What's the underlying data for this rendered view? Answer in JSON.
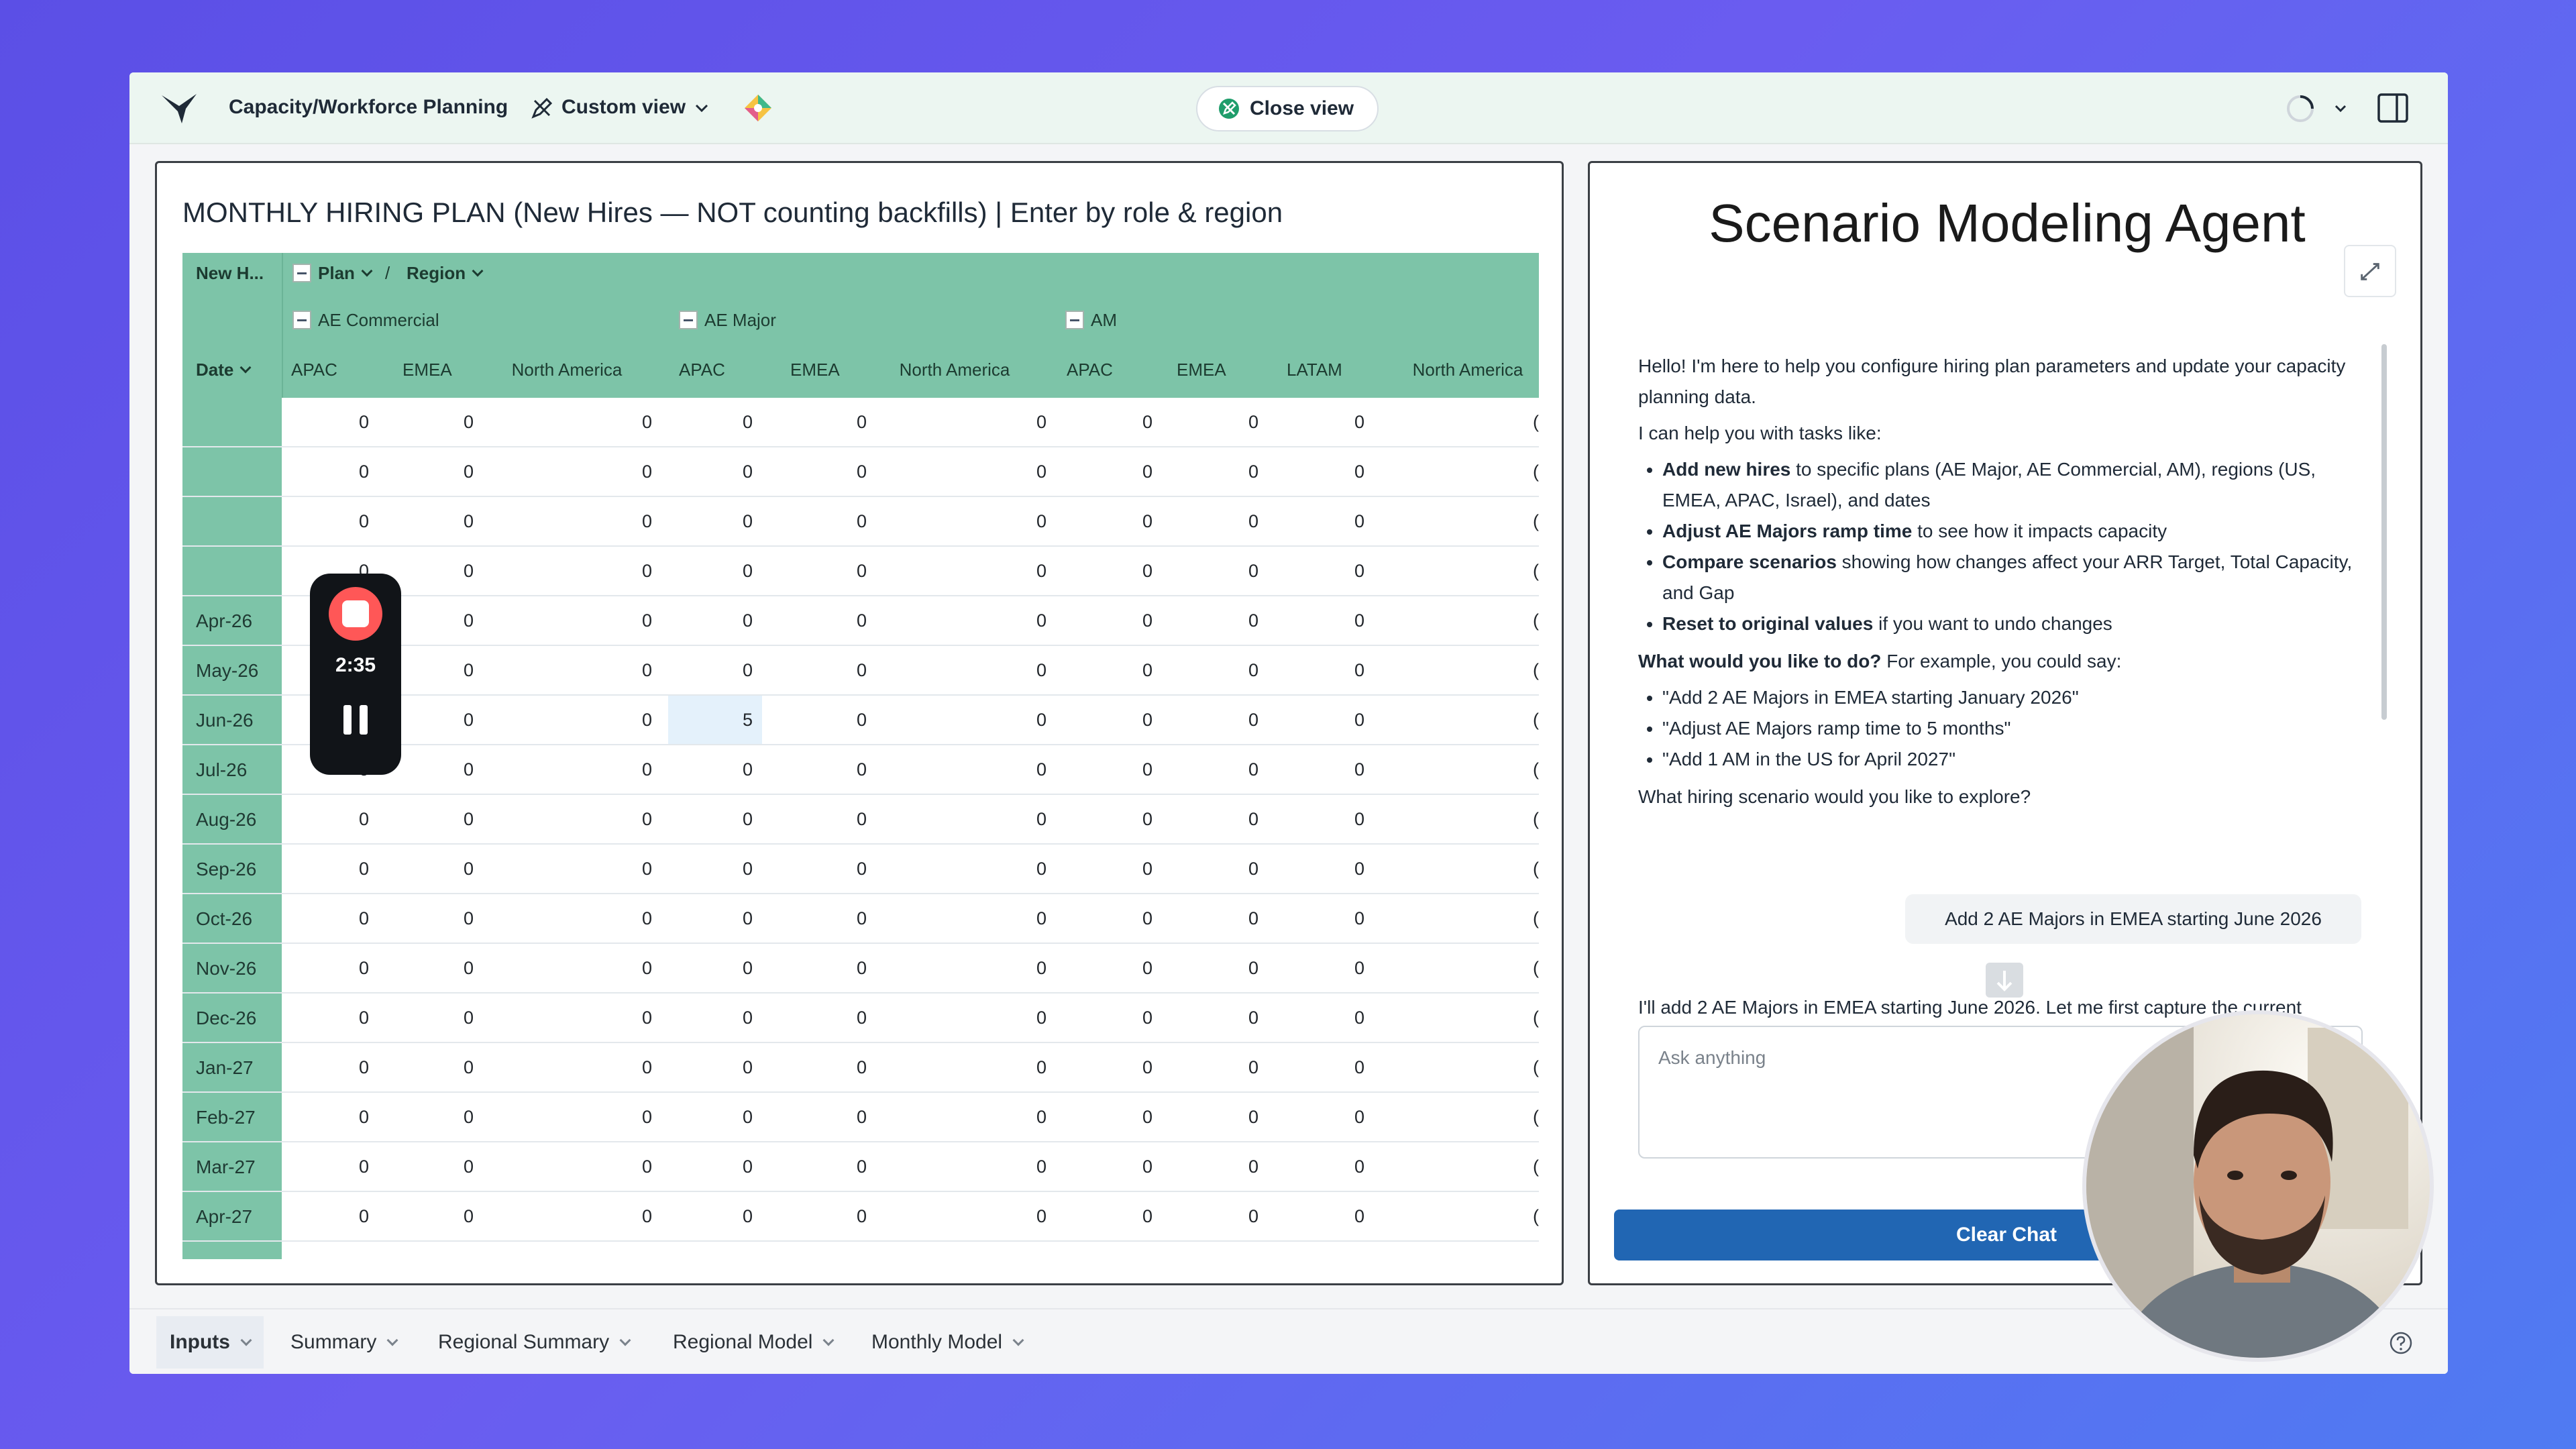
{
  "topbar": {
    "title": "Capacity/Workforce Planning",
    "view_label": "Custom view",
    "close_view_label": "Close view"
  },
  "left_panel": {
    "title": "MONTHLY HIRING PLAN (New Hires — NOT counting backfills) | Enter by role & region",
    "corner_label": "New H...",
    "plan_label": "Plan",
    "slash": "/",
    "region_label": "Region",
    "date_label": "Date",
    "groups": [
      "AE Commercial",
      "AE Major",
      "AM"
    ],
    "columns": [
      "APAC",
      "EMEA",
      "North America",
      "APAC",
      "EMEA",
      "North America",
      "APAC",
      "EMEA",
      "LATAM",
      "North America"
    ],
    "rows": [
      {
        "date": "",
        "values": [
          0,
          0,
          0,
          0,
          0,
          0,
          0,
          0,
          0
        ]
      },
      {
        "date": "",
        "values": [
          0,
          0,
          0,
          0,
          0,
          0,
          0,
          0,
          0
        ]
      },
      {
        "date": "",
        "values": [
          0,
          0,
          0,
          0,
          0,
          0,
          0,
          0,
          0
        ]
      },
      {
        "date": "",
        "values": [
          0,
          0,
          0,
          0,
          0,
          0,
          0,
          0,
          0
        ]
      },
      {
        "date": "Apr-26",
        "values": [
          0,
          0,
          0,
          0,
          0,
          0,
          0,
          0,
          0
        ]
      },
      {
        "date": "May-26",
        "values": [
          0,
          0,
          0,
          0,
          0,
          0,
          0,
          0,
          0
        ]
      },
      {
        "date": "Jun-26",
        "values": [
          0,
          0,
          0,
          5,
          0,
          0,
          0,
          0,
          0
        ]
      },
      {
        "date": "Jul-26",
        "values": [
          0,
          0,
          0,
          0,
          0,
          0,
          0,
          0,
          0
        ]
      },
      {
        "date": "Aug-26",
        "values": [
          0,
          0,
          0,
          0,
          0,
          0,
          0,
          0,
          0
        ]
      },
      {
        "date": "Sep-26",
        "values": [
          0,
          0,
          0,
          0,
          0,
          0,
          0,
          0,
          0
        ]
      },
      {
        "date": "Oct-26",
        "values": [
          0,
          0,
          0,
          0,
          0,
          0,
          0,
          0,
          0
        ]
      },
      {
        "date": "Nov-26",
        "values": [
          0,
          0,
          0,
          0,
          0,
          0,
          0,
          0,
          0
        ]
      },
      {
        "date": "Dec-26",
        "values": [
          0,
          0,
          0,
          0,
          0,
          0,
          0,
          0,
          0
        ]
      },
      {
        "date": "Jan-27",
        "values": [
          0,
          0,
          0,
          0,
          0,
          0,
          0,
          0,
          0
        ]
      },
      {
        "date": "Feb-27",
        "values": [
          0,
          0,
          0,
          0,
          0,
          0,
          0,
          0,
          0
        ]
      },
      {
        "date": "Mar-27",
        "values": [
          0,
          0,
          0,
          0,
          0,
          0,
          0,
          0,
          0
        ]
      },
      {
        "date": "Apr-27",
        "values": [
          0,
          0,
          0,
          0,
          0,
          0,
          0,
          0,
          0
        ]
      }
    ],
    "trailing_glyph": "(",
    "highlighted_cell": {
      "row": 6,
      "col": 3
    }
  },
  "recorder": {
    "time": "2:35"
  },
  "right_panel": {
    "title": "Scenario Modeling Agent",
    "intro": "Hello! I'm here to help you configure hiring plan parameters and update your capacity planning data.",
    "tasks_intro": "I can help you with tasks like:",
    "tasks": [
      {
        "bold": "Add new hires",
        "rest": " to specific plans (AE Major, AE Commercial, AM), regions (US, EMEA, APAC, Israel), and dates"
      },
      {
        "bold": "Adjust AE Majors ramp time",
        "rest": " to see how it impacts capacity"
      },
      {
        "bold": "Compare scenarios",
        "rest": " showing how changes affect your ARR Target, Total Capacity, and Gap"
      },
      {
        "bold": "Reset to original values",
        "rest": " if you want to undo changes"
      }
    ],
    "question_bold": "What would you like to do?",
    "question_rest": " For example, you could say:",
    "examples": [
      "\"Add 2 AE Majors in EMEA starting January 2026\"",
      "\"Adjust AE Majors ramp time to 5 months\"",
      "\"Add 1 AM in the US for April 2027\""
    ],
    "closing": "What hiring scenario would you like to explore?",
    "user_message": "Add 2 AE Majors in EMEA starting June 2026",
    "assistant_partial": "I'll add 2 AE Majors in EMEA starting June 2026. Let me first capture the current",
    "input_placeholder": "Ask anything",
    "clear_label": "Clear Chat"
  },
  "tabs": [
    {
      "label": "Inputs",
      "active": true
    },
    {
      "label": "Summary",
      "active": false
    },
    {
      "label": "Regional Summary",
      "active": false
    },
    {
      "label": "Regional Model",
      "active": false
    },
    {
      "label": "Monthly Model",
      "active": false
    }
  ],
  "colors": {
    "grid_header": "#7dc4a8",
    "clear_button": "#2166b3",
    "record_stop": "#ff5757",
    "background_gradient_start": "#5b4fe6"
  }
}
